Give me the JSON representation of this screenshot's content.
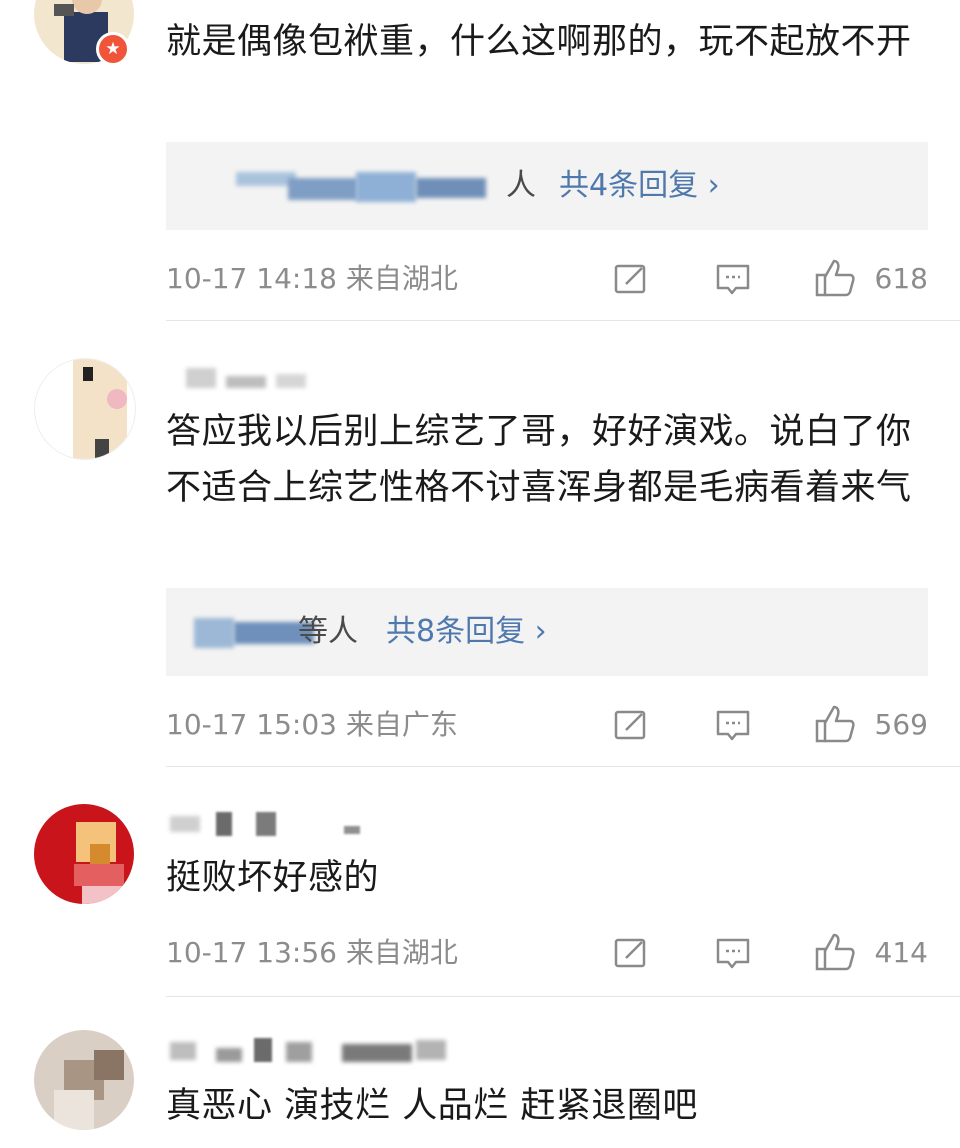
{
  "comments": [
    {
      "text": "就是偶像包袱重，什么这啊那的，玩不起放不开",
      "replies": {
        "names": "个美逗…等",
        "suffix": "人",
        "count_label": "共4条回复 ›"
      },
      "meta": {
        "time": "10-17 14:18",
        "location": "来自湖北",
        "likes": "618"
      }
    },
    {
      "text": "答应我以后别上综艺了哥，好好演戏。说白了你不适合上综艺性格不讨喜浑身都是毛病看着来气",
      "replies": {
        "names": "独…",
        "suffix": "等人",
        "count_label": "共8条回复 ›"
      },
      "meta": {
        "time": "10-17 15:03",
        "location": "来自广东",
        "likes": "569"
      }
    },
    {
      "text": "挺败坏好感的",
      "meta": {
        "time": "10-17 13:56",
        "location": "来自湖北",
        "likes": "414"
      }
    },
    {
      "text": "真恶心 演技烂 人品烂 赶紧退圈吧"
    }
  ],
  "icons": {
    "repost": "share-icon",
    "comment": "comment-icon",
    "like": "thumbs-up-icon",
    "badge": "verified-badge-icon"
  },
  "colors": {
    "reply_link": "#4f79ad",
    "reply_bg": "#f3f3f3",
    "meta_text": "#8c8c8c",
    "badge": "#f0553a"
  }
}
